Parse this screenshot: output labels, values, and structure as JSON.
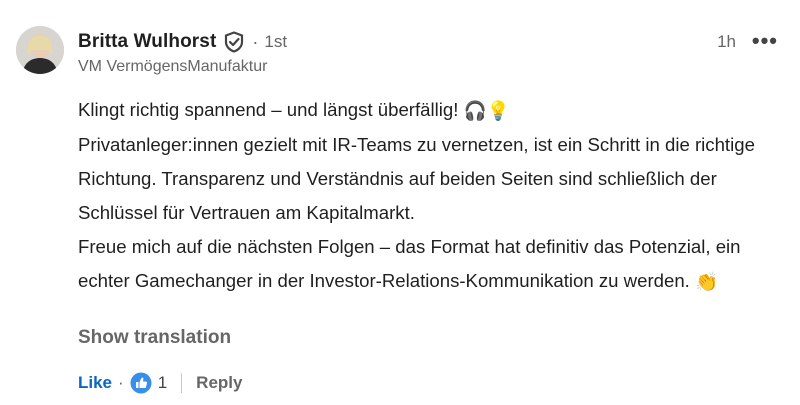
{
  "author": {
    "name": "Britta Wulhorst",
    "degree": "1st",
    "subtitle": "VM VermögensManufaktur",
    "verified_icon": "shield-check-icon"
  },
  "meta": {
    "time": "1h",
    "more_label": "•••"
  },
  "comment": {
    "line1": "Klingt richtig spannend – und längst überfällig!",
    "line2": "Privatanleger:innen gezielt mit IR-Teams zu vernetzen, ist ein Schritt in die richtige Richtung. Transparenz und Verständnis auf beiden Seiten sind schließlich der Schlüssel für Vertrauen am Kapitalmarkt.",
    "line3": "Freue mich auf die nächsten Folgen – das Format hat definitiv das Potenzial, ein echter Gamechanger in der Investor-Relations-Kommunikation zu werden.",
    "emoji_headphones": "🎧",
    "emoji_bulb": "💡",
    "emoji_clap": "👏"
  },
  "show_translation": "Show translation",
  "actions": {
    "like_label": "Like",
    "dot": "·",
    "reaction_icon": "thumbs-up-icon",
    "reaction_count": "1",
    "reply_label": "Reply"
  },
  "colors": {
    "link": "#0a66c2",
    "muted": "#666666"
  }
}
